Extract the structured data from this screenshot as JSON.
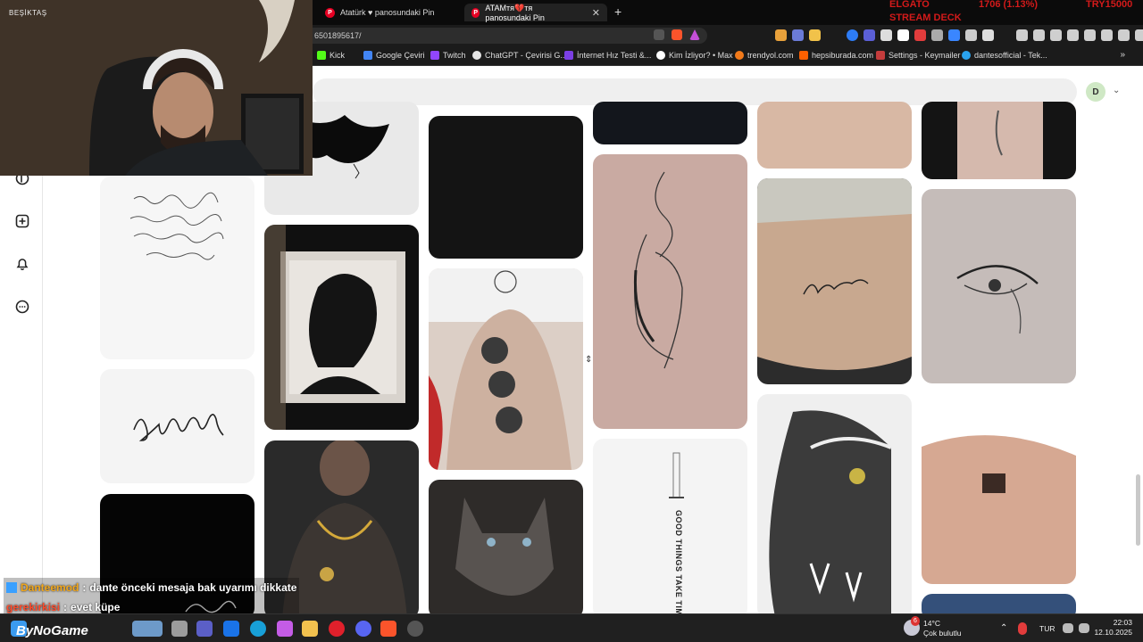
{
  "browser": {
    "tabs": [
      {
        "label": "Atatürk ♥ panosundaki Pin"
      },
      {
        "label": "ATAMтя💔тя panosundaki Pin"
      }
    ],
    "new_tab": "+",
    "url": "6501895617/",
    "ticker": {
      "line1_a": "ELGATO",
      "line1_b": "1706 (1.13%)",
      "line1_c": "TRY15000",
      "line2": "STREAM DECK"
    },
    "bookmarks": [
      "Kick",
      "Google Çeviri",
      "Twitch",
      "ChatGPT - Çevirisi G...",
      "İnternet Hız Testi &...",
      "Kim İzliyor? • Max",
      "trendyol.com",
      "hepsiburada.com",
      "Settings - Keymailer",
      "dantesofficial - Tek..."
    ],
    "bookmarks_more": "»"
  },
  "pinterest": {
    "avatar_letter": "D",
    "chevron": "⌄",
    "rail_icons": [
      "pinterest-icon",
      "create-icon",
      "notifications-icon",
      "messages-icon"
    ]
  },
  "webcam": {
    "tag": "BEŞİKTAŞ"
  },
  "chat": [
    {
      "user": "Danteemod",
      "sep": ":",
      "message": "dante önceki mesaja bak uyarımı dikkate"
    },
    {
      "user": "gerekirkisi",
      "sep": ":",
      "message": "evet küpe"
    }
  ],
  "taskbar": {
    "brand": "ByNoGame",
    "weather_temp": "14°C",
    "weather_desc": "Çok bulutlu",
    "weather_badge": "6",
    "lang": "TUR",
    "time": "22:03",
    "date": "12.10.2025"
  },
  "colors": {
    "pinterest_red": "#e60023",
    "ticker_red": "#d21a1a",
    "taskbar": "#202020"
  }
}
